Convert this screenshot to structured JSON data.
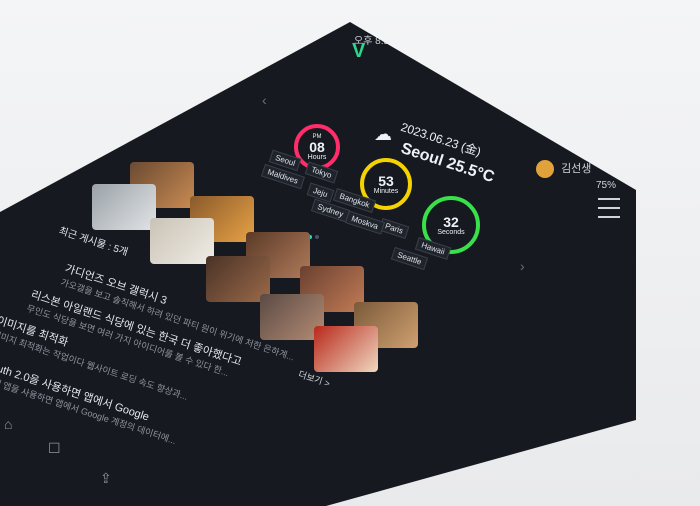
{
  "status": {
    "time": "오후 8:53",
    "battery": "75%"
  },
  "user": {
    "name": "김선생"
  },
  "weather": {
    "date": "2023.06.23 (金)",
    "city_temp": "Seoul 25.5°C"
  },
  "clock": [
    {
      "value": "08",
      "unit": "Hours",
      "sup": "PM",
      "color": "#ff2d6a"
    },
    {
      "value": "53",
      "unit": "Minutes",
      "sup": "",
      "color": "#f5d300"
    },
    {
      "value": "32",
      "unit": "Seconds",
      "sup": "",
      "color": "#38e04a"
    }
  ],
  "cities": [
    "Seoul",
    "Tokyo",
    "Jeju",
    "Maldives",
    "Bangkok",
    "Sydney",
    "Paris",
    "Moskva",
    "Hawaii",
    "Seattle"
  ],
  "board": {
    "header": "최근 게시물 : 5개",
    "more_label": "더보기 >"
  },
  "posts": [
    {
      "title": "가디언즈 오브 갤럭시 3",
      "sub": "가오갤을 보고 솔직해서 하려 있던 파티 원이 위기에 처한 은하계..."
    },
    {
      "title": "리스본 아일랜드 식당에 있는 한국 더 좋아했다고",
      "sub": "무인도 식당을 보면 여러 가지 아이디어를 볼 수 있다 한..."
    },
    {
      "title": "이미지를 최적화",
      "sub": "이미지 최적화는 작업이다 웹사이트 로딩 속도 향상과..."
    },
    {
      "title": "uth 2.0을 사용하면 앱에서 Google",
      "sub": "내 앱을 사용하면 앱에서 Google 계정의 데이터에..."
    }
  ],
  "nav": [
    "home-icon",
    "chat-icon",
    "share-icon"
  ]
}
